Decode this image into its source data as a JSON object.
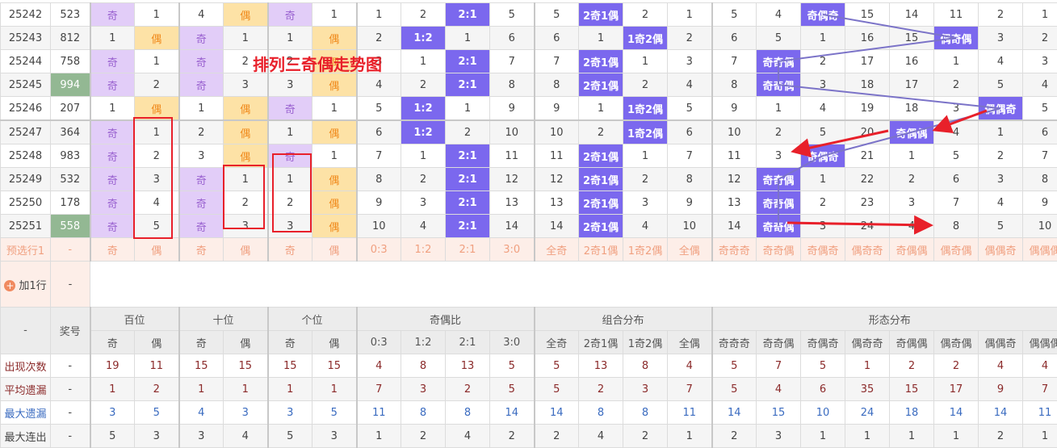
{
  "title_overlay": "排列三奇偶走势图",
  "col_labels": [
    "奇",
    "偶",
    "奇",
    "偶",
    "奇",
    "偶",
    "0:3",
    "1:2",
    "2:1",
    "3:0",
    "全奇",
    "2奇1偶",
    "1奇2偶",
    "全偶",
    "奇奇奇",
    "奇奇偶",
    "奇偶奇",
    "偶奇奇",
    "奇偶偶",
    "偶奇偶",
    "偶偶奇",
    "偶偶偶"
  ],
  "rows": [
    {
      "issue": "25242",
      "number": "523",
      "green": false,
      "cells": [
        "奇",
        "1",
        "4",
        "偶",
        "奇",
        "1",
        "1",
        "2",
        "2:1",
        "5",
        "5",
        "2奇1偶",
        "2",
        "1",
        "5",
        "4",
        "奇偶奇",
        "15",
        "14",
        "11",
        "2",
        "1"
      ]
    },
    {
      "issue": "25243",
      "number": "812",
      "green": false,
      "cells": [
        "1",
        "偶",
        "奇",
        "1",
        "1",
        "偶",
        "2",
        "1:2",
        "1",
        "6",
        "6",
        "1",
        "1奇2偶",
        "2",
        "6",
        "5",
        "1",
        "16",
        "15",
        "偶奇偶",
        "3",
        "2"
      ]
    },
    {
      "issue": "25244",
      "number": "758",
      "green": false,
      "cells": [
        "奇",
        "1",
        "奇",
        "2",
        "2",
        "偶",
        "3",
        "1",
        "2:1",
        "7",
        "7",
        "2奇1偶",
        "1",
        "3",
        "7",
        "奇奇偶",
        "2",
        "17",
        "16",
        "1",
        "4",
        "3"
      ]
    },
    {
      "issue": "25245",
      "number": "994",
      "green": true,
      "cells": [
        "奇",
        "2",
        "奇",
        "3",
        "3",
        "偶",
        "4",
        "2",
        "2:1",
        "8",
        "8",
        "2奇1偶",
        "2",
        "4",
        "8",
        "奇奇偶",
        "3",
        "18",
        "17",
        "2",
        "5",
        "4"
      ]
    },
    {
      "issue": "25246",
      "number": "207",
      "green": false,
      "cells": [
        "1",
        "偶",
        "1",
        "偶",
        "奇",
        "1",
        "5",
        "1:2",
        "1",
        "9",
        "9",
        "1",
        "1奇2偶",
        "5",
        "9",
        "1",
        "4",
        "19",
        "18",
        "3",
        "偶偶奇",
        "5"
      ]
    },
    {
      "issue": "25247",
      "number": "364",
      "green": false,
      "cells": [
        "奇",
        "1",
        "2",
        "偶",
        "1",
        "偶",
        "6",
        "1:2",
        "2",
        "10",
        "10",
        "2",
        "1奇2偶",
        "6",
        "10",
        "2",
        "5",
        "20",
        "奇偶偶",
        "4",
        "1",
        "6"
      ]
    },
    {
      "issue": "25248",
      "number": "983",
      "green": false,
      "cells": [
        "奇",
        "2",
        "3",
        "偶",
        "奇",
        "1",
        "7",
        "1",
        "2:1",
        "11",
        "11",
        "2奇1偶",
        "1",
        "7",
        "11",
        "3",
        "奇偶奇",
        "21",
        "1",
        "5",
        "2",
        "7"
      ]
    },
    {
      "issue": "25249",
      "number": "532",
      "green": false,
      "cells": [
        "奇",
        "3",
        "奇",
        "1",
        "1",
        "偶",
        "8",
        "2",
        "2:1",
        "12",
        "12",
        "2奇1偶",
        "2",
        "8",
        "12",
        "奇奇偶",
        "1",
        "22",
        "2",
        "6",
        "3",
        "8"
      ]
    },
    {
      "issue": "25250",
      "number": "178",
      "green": false,
      "cells": [
        "奇",
        "4",
        "奇",
        "2",
        "2",
        "偶",
        "9",
        "3",
        "2:1",
        "13",
        "13",
        "2奇1偶",
        "3",
        "9",
        "13",
        "奇奇偶",
        "2",
        "23",
        "3",
        "7",
        "4",
        "9"
      ]
    },
    {
      "issue": "25251",
      "number": "558",
      "green": true,
      "cells": [
        "奇",
        "5",
        "奇",
        "3",
        "3",
        "偶",
        "10",
        "4",
        "2:1",
        "14",
        "14",
        "2奇1偶",
        "4",
        "10",
        "14",
        "奇奇偶",
        "3",
        "24",
        "4",
        "8",
        "5",
        "10"
      ]
    }
  ],
  "preselect": {
    "label": "预选行1",
    "dash": "-"
  },
  "add_row": {
    "label": "加1行",
    "dash": "-"
  },
  "footer_header": {
    "dash": "-",
    "number_label": "奖号",
    "groups": [
      "百位",
      "十位",
      "个位",
      "奇偶比",
      "组合分布",
      "形态分布"
    ]
  },
  "stats": [
    {
      "label": "出现次数",
      "dash": "-",
      "tone": "red",
      "values": [
        "19",
        "11",
        "15",
        "15",
        "15",
        "15",
        "4",
        "8",
        "13",
        "5",
        "5",
        "13",
        "8",
        "4",
        "5",
        "7",
        "5",
        "1",
        "2",
        "2",
        "4",
        "4"
      ]
    },
    {
      "label": "平均遗漏",
      "dash": "-",
      "tone": "red",
      "values": [
        "1",
        "2",
        "1",
        "1",
        "1",
        "1",
        "7",
        "3",
        "2",
        "5",
        "5",
        "2",
        "3",
        "7",
        "5",
        "4",
        "6",
        "35",
        "15",
        "17",
        "9",
        "7"
      ]
    },
    {
      "label": "最大遗漏",
      "dash": "-",
      "tone": "bl",
      "values": [
        "3",
        "5",
        "4",
        "3",
        "3",
        "5",
        "11",
        "8",
        "8",
        "14",
        "14",
        "8",
        "8",
        "11",
        "14",
        "15",
        "10",
        "24",
        "18",
        "14",
        "14",
        "11"
      ]
    },
    {
      "label": "最大连出",
      "dash": "-",
      "tone": "gr",
      "values": [
        "5",
        "3",
        "3",
        "4",
        "5",
        "3",
        "1",
        "2",
        "4",
        "2",
        "2",
        "4",
        "2",
        "1",
        "2",
        "3",
        "1",
        "1",
        "1",
        "1",
        "2",
        "1"
      ]
    }
  ],
  "colors": {
    "odd_bg": "#e2cdf8",
    "even_bg": "#fde2a6",
    "highlight": "#7b68ee",
    "annotation": "#e8202a"
  }
}
